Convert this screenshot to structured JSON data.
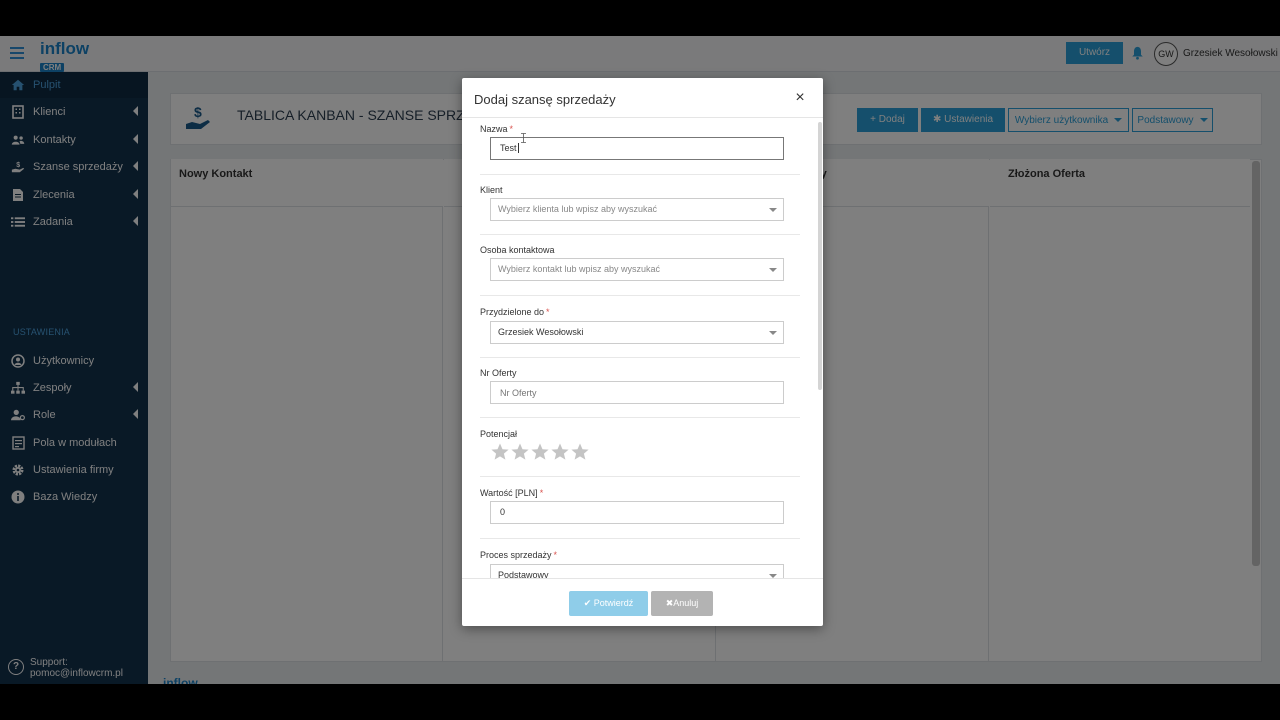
{
  "topbar": {
    "logo_main": "inflow",
    "logo_sub": "CRM",
    "create_label": "Utwórz",
    "avatar_initials": "GW",
    "user_name": "Grzesiek Wesołowski"
  },
  "sidebar": {
    "items": [
      {
        "label": "Pulpit",
        "icon": "home-icon"
      },
      {
        "label": "Klienci",
        "icon": "building-icon"
      },
      {
        "label": "Kontakty",
        "icon": "users-icon"
      },
      {
        "label": "Szanse sprzedaży",
        "icon": "hand-money-icon"
      },
      {
        "label": "Zlecenia",
        "icon": "document-icon"
      },
      {
        "label": "Zadania",
        "icon": "list-icon"
      }
    ],
    "settings_heading": "USTAWIENIA",
    "settings_items": [
      {
        "label": "Użytkownicy",
        "icon": "user-circle-icon"
      },
      {
        "label": "Zespoły",
        "icon": "sitemap-icon"
      },
      {
        "label": "Role",
        "icon": "user-gear-icon"
      },
      {
        "label": "Pola w modułach",
        "icon": "form-icon"
      },
      {
        "label": "Ustawienia firmy",
        "icon": "gear-icon"
      },
      {
        "label": "Baza Wiedzy",
        "icon": "info-icon"
      }
    ],
    "support_label": "Support:",
    "support_email": "pomoc@inflowcrm.pl"
  },
  "main": {
    "title": "TABLICA KANBAN - SZANSE SPRZEDAŻY",
    "add_label": "Dodaj",
    "settings_label": "Ustawienia",
    "user_select": "Wybierz użytkownika",
    "process_select": "Podstawowy",
    "columns": [
      "Nowy Kontakt",
      "",
      "ty",
      "Złożona Oferta"
    ],
    "footer_logo": "inflow"
  },
  "modal": {
    "title": "Dodaj szansę sprzedaży",
    "close": "×",
    "fields": {
      "name_label": "Nazwa",
      "name_value": "Test",
      "client_label": "Klient",
      "client_placeholder": "Wybierz klienta lub wpisz aby wyszukać",
      "contact_label": "Osoba kontaktowa",
      "contact_placeholder": "Wybierz kontakt lub wpisz aby wyszukać",
      "assigned_label": "Przydzielone do",
      "assigned_value": "Grzesiek Wesołowski",
      "offer_label": "Nr Oferty",
      "offer_placeholder": "Nr Oferty",
      "potential_label": "Potencjał",
      "potential_value": 0,
      "potential_max": 5,
      "value_label": "Wartość [PLN]",
      "value_value": "0",
      "process_label": "Proces sprzedaży",
      "process_value": "Podstawowy"
    },
    "required_mark": "*",
    "confirm_label": "Potwierdź",
    "cancel_label": "Anuluj"
  },
  "colors": {
    "sidebar_bg": "#12324d",
    "accent": "#2a9fd8",
    "required": "#d9534f"
  }
}
